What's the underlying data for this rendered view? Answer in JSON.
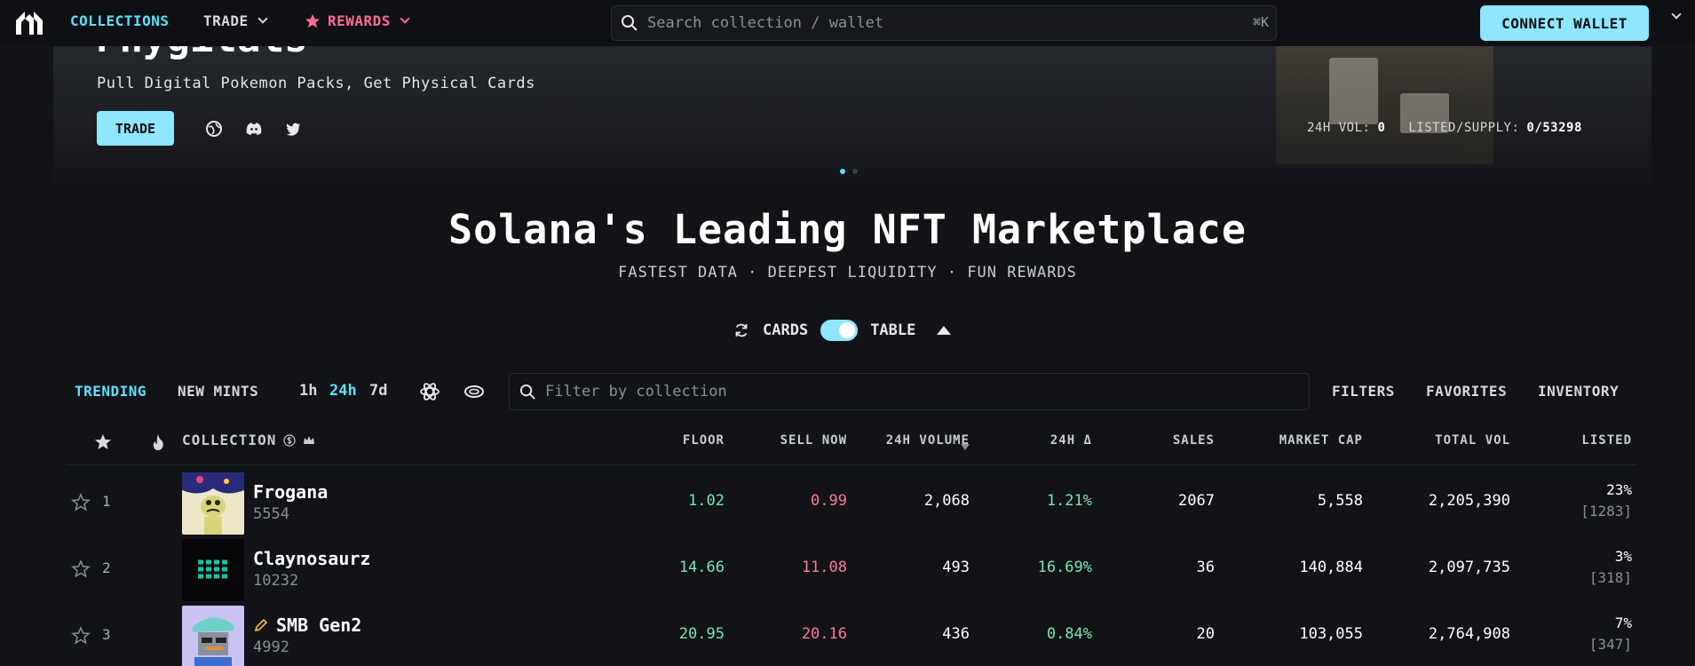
{
  "nav": {
    "collections": "COLLECTIONS",
    "trade": "TRADE",
    "rewards": "REWARDS",
    "search_placeholder": "Search collection / wallet",
    "search_shortcut": "⌘K",
    "connect_wallet": "CONNECT WALLET"
  },
  "hero": {
    "title": "Phygitals",
    "subtitle": "Pull Digital Pokemon Packs, Get Physical Cards",
    "trade_button": "TRADE",
    "stats": {
      "vol_label": "24H VOL:",
      "vol_value": "0",
      "listed_label": "LISTED/SUPPLY:",
      "listed_value": "0/53298"
    }
  },
  "headline": "Solana's Leading NFT Marketplace",
  "tagline": "FASTEST DATA · DEEPEST LIQUIDITY · FUN REWARDS",
  "view_toggle": {
    "cards": "CARDS",
    "table": "TABLE"
  },
  "filters": {
    "trending": "TRENDING",
    "new_mints": "NEW MINTS",
    "tf_1h": "1h",
    "tf_24h": "24h",
    "tf_7d": "7d",
    "filter_placeholder": "Filter by collection",
    "filters_link": "FILTERS",
    "favorites_link": "FAVORITES",
    "inventory_link": "INVENTORY"
  },
  "table": {
    "headers": {
      "collection": "COLLECTION",
      "floor": "FLOOR",
      "sell_now": "SELL NOW",
      "volume_24h": "24H VOLUME",
      "change_24h": "24H Δ",
      "sales": "SALES",
      "market_cap": "MARKET CAP",
      "total_vol": "TOTAL VOL",
      "listed": "LISTED"
    },
    "rows": [
      {
        "rank": "1",
        "name": "Frogana",
        "supply": "5554",
        "floor": "1.02",
        "sell_now": "0.99",
        "volume_24h": "2,068",
        "change_24h": "1.21%",
        "sales": "2067",
        "market_cap": "5,558",
        "total_vol": "2,205,390",
        "listed_pct": "23%",
        "listed_count": "[1283]"
      },
      {
        "rank": "2",
        "name": "Claynosaurz",
        "supply": "10232",
        "floor": "14.66",
        "sell_now": "11.08",
        "volume_24h": "493",
        "change_24h": "16.69%",
        "sales": "36",
        "market_cap": "140,884",
        "total_vol": "2,097,735",
        "listed_pct": "3%",
        "listed_count": "[318]"
      },
      {
        "rank": "3",
        "name": "SMB Gen2",
        "supply": "4992",
        "floor": "20.95",
        "sell_now": "20.16",
        "volume_24h": "436",
        "change_24h": "0.84%",
        "sales": "20",
        "market_cap": "103,055",
        "total_vol": "2,764,908",
        "listed_pct": "7%",
        "listed_count": "[347]"
      }
    ]
  },
  "colors": {
    "accent": "#5ee1ff",
    "rewards": "#ff6a9a",
    "positive": "#7fe3b4",
    "negative": "#ff7a9a",
    "button": "#8fe6ff"
  }
}
